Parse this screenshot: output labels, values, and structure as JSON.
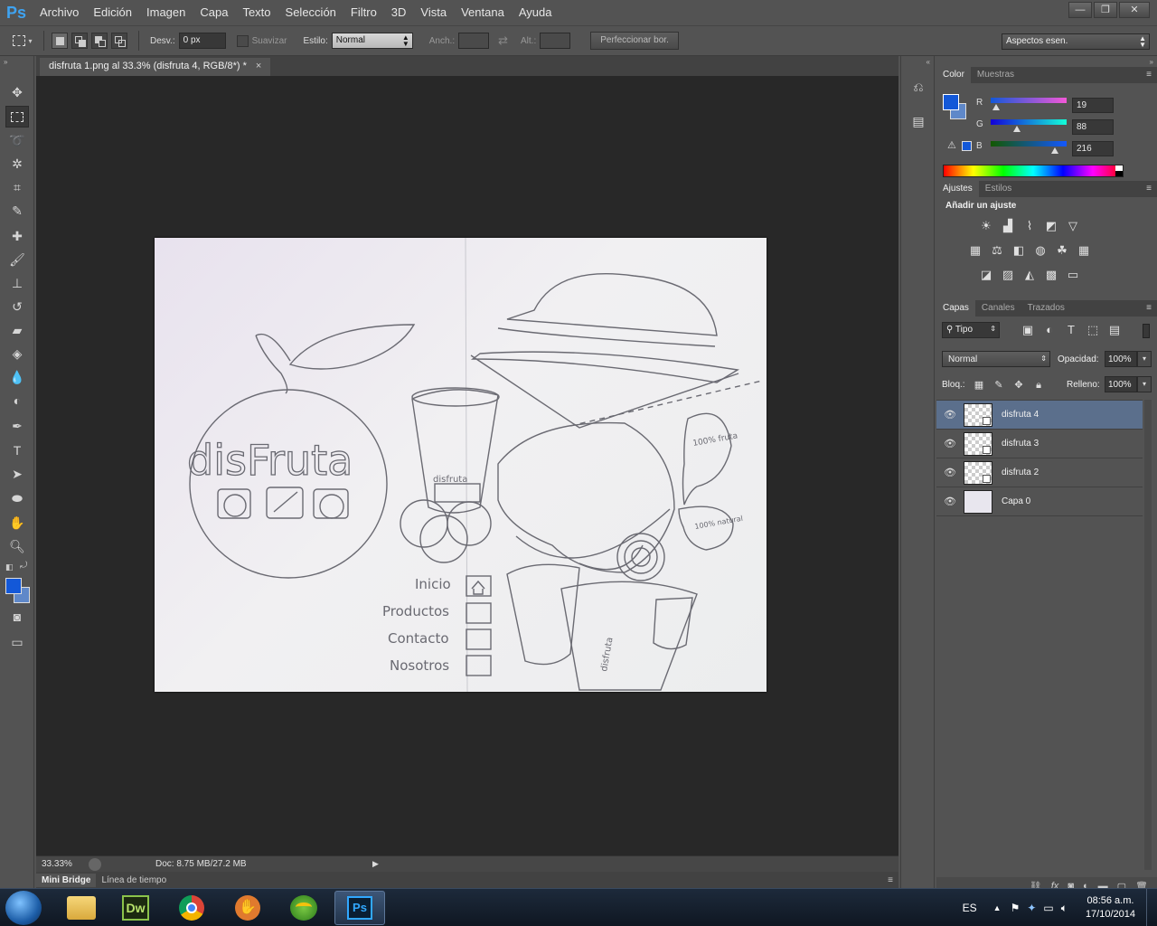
{
  "app": {
    "logo": "Ps"
  },
  "menu": [
    "Archivo",
    "Edición",
    "Imagen",
    "Capa",
    "Texto",
    "Selección",
    "Filtro",
    "3D",
    "Vista",
    "Ventana",
    "Ayuda"
  ],
  "window_controls": {
    "minimize": "—",
    "restore": "❐",
    "close": "✕"
  },
  "options": {
    "desv_label": "Desv.:",
    "desv_value": "0 px",
    "suavizar_label": "Suavizar",
    "estilo_label": "Estilo:",
    "estilo_value": "Normal",
    "anch_label": "Anch.:",
    "alt_label": "Alt.:",
    "refine_button": "Perfeccionar bor.",
    "workspace": "Aspectos esen."
  },
  "document": {
    "tab_title": "disfruta 1.png al 33.3% (disfruta 4, RGB/8*) *",
    "close": "×",
    "zoom": "33.33%",
    "doc_info": "Doc: 8.75 MB/27.2 MB"
  },
  "artwork": {
    "logo_text": "disFruta",
    "nav_items": [
      "Inicio",
      "Productos",
      "Contacto",
      "Nosotros"
    ],
    "cup_text": "disfruta",
    "bubble_1": "100% fruta",
    "bubble_2": "100% natural"
  },
  "bottom_tabs": [
    "Mini Bridge",
    "Línea de tiempo"
  ],
  "color_panel": {
    "tabs": [
      "Color",
      "Muestras"
    ],
    "r_label": "R",
    "g_label": "G",
    "b_label": "B",
    "r": "19",
    "g": "88",
    "b": "216",
    "r_level": 0.07,
    "g_level": 0.35,
    "b_level": 0.85,
    "foreground": "#1358d8",
    "background": "#5f88c9"
  },
  "adjust_panel": {
    "tabs": [
      "Ajustes",
      "Estilos"
    ],
    "heading": "Añadir un ajuste"
  },
  "layers_panel": {
    "tabs": [
      "Capas",
      "Canales",
      "Trazados"
    ],
    "filter": "Tipo",
    "blend_mode": "Normal",
    "opacity_label": "Opacidad:",
    "opacity": "100%",
    "lock_label": "Bloq.:",
    "fill_label": "Relleno:",
    "fill": "100%",
    "layers": [
      {
        "name": "disfruta 4",
        "selected": true
      },
      {
        "name": "disfruta 3",
        "selected": false
      },
      {
        "name": "disfruta 2",
        "selected": false
      },
      {
        "name": "Capa 0",
        "selected": false
      }
    ]
  },
  "taskbar": {
    "language": "ES",
    "time": "08:56 a.m.",
    "date": "17/10/2014",
    "dw_label": "Dw",
    "ps_label": "Ps"
  }
}
